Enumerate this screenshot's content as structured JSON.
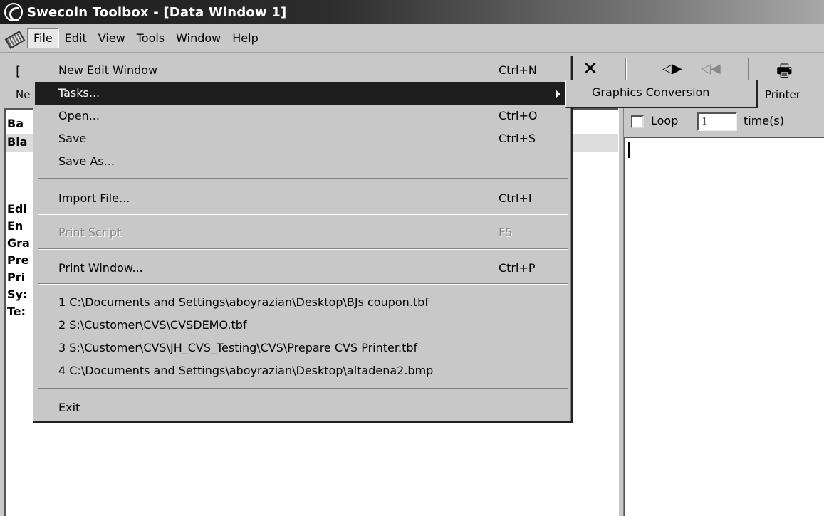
{
  "window": {
    "title": "Swecoin Toolbox - [Data Window 1]"
  },
  "menubar": {
    "items": [
      "File",
      "Edit",
      "View",
      "Tools",
      "Window",
      "Help"
    ]
  },
  "toolbar": {
    "fragment_bracket": "[",
    "fragment_ne": "Ne",
    "printer_label": "Printer"
  },
  "left_panel": {
    "rows": [
      "Ba",
      "Bla",
      "Edi",
      "En",
      "Gra",
      "Pre",
      "Pri",
      "Sy:",
      "Te:"
    ]
  },
  "right_panel": {
    "loop_label": "Loop",
    "loop_value": "1",
    "times_label": "time(s)"
  },
  "file_menu": {
    "new_edit_window": {
      "label": "New Edit Window",
      "shortcut": "Ctrl+N"
    },
    "tasks": {
      "label": "Tasks..."
    },
    "open": {
      "label": "Open...",
      "shortcut": "Ctrl+O"
    },
    "save": {
      "label": "Save",
      "shortcut": "Ctrl+S"
    },
    "save_as": {
      "label": "Save As..."
    },
    "import_file": {
      "label": "Import File...",
      "shortcut": "Ctrl+I"
    },
    "print_script": {
      "label": "Print Script",
      "shortcut": "F5"
    },
    "print_window": {
      "label": "Print Window...",
      "shortcut": "Ctrl+P"
    },
    "recent": [
      "1 C:\\Documents and Settings\\aboyrazian\\Desktop\\BJs coupon.tbf",
      "2 S:\\Customer\\CVS\\CVSDEMO.tbf",
      "3 S:\\Customer\\CVS\\JH_CVS_Testing\\CVS\\Prepare CVS Printer.tbf",
      "4 C:\\Documents and Settings\\aboyrazian\\Desktop\\altadena2.bmp"
    ],
    "exit": {
      "label": "Exit"
    }
  },
  "tasks_submenu": {
    "items": [
      "Graphics Conversion"
    ]
  }
}
